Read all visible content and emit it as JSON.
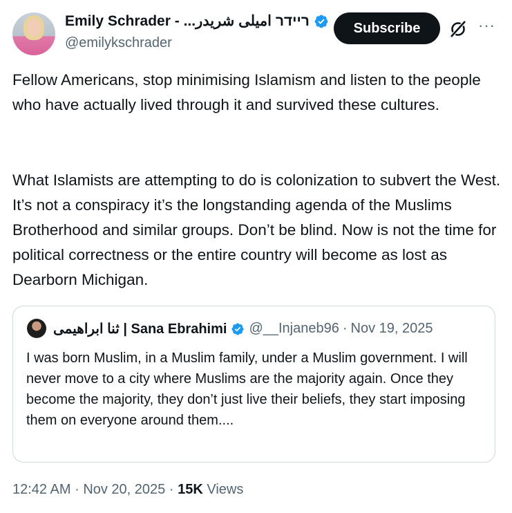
{
  "author": {
    "display_name": "Emily Schrader - ...ריידר امیلی شریدر",
    "handle": "@emilykschrader",
    "verified_icon": "verified-badge-icon"
  },
  "actions": {
    "subscribe_label": "Subscribe",
    "grok_icon": "grok-icon",
    "more_label": "···"
  },
  "post": {
    "paragraph1": "Fellow Americans, stop minimising Islamism and listen to the people who have actually lived through it and survived these cultures.",
    "paragraph2": "What Islamists are attempting to do is colonization to subvert the West. It’s not a conspiracy it’s the longstanding agenda of the Muslims Brotherhood and similar groups. Don’t be blind. Now is not the time for political correctness or the entire country will become as lost as Dearborn Michigan."
  },
  "quote": {
    "display_name": "ثنا ابراهیمی | Sana Ebrahimi",
    "handle": "@__Injaneb96",
    "separator": "·",
    "date": "Nov 19, 2025",
    "text": "I was born Muslim, in a Muslim family, under a Muslim government. I will never move to a city where Muslims are the majority again. Once they become the majority, they don’t just live their beliefs, they start imposing them on everyone around them...."
  },
  "meta": {
    "time": "12:42 AM",
    "separator": "·",
    "date": "Nov 20, 2025",
    "views_count": "15K",
    "views_label": "Views"
  },
  "colors": {
    "verified_blue": "#1d9bf0",
    "text_primary": "#0f1419",
    "text_secondary": "#536471",
    "border": "#cfd9de"
  }
}
